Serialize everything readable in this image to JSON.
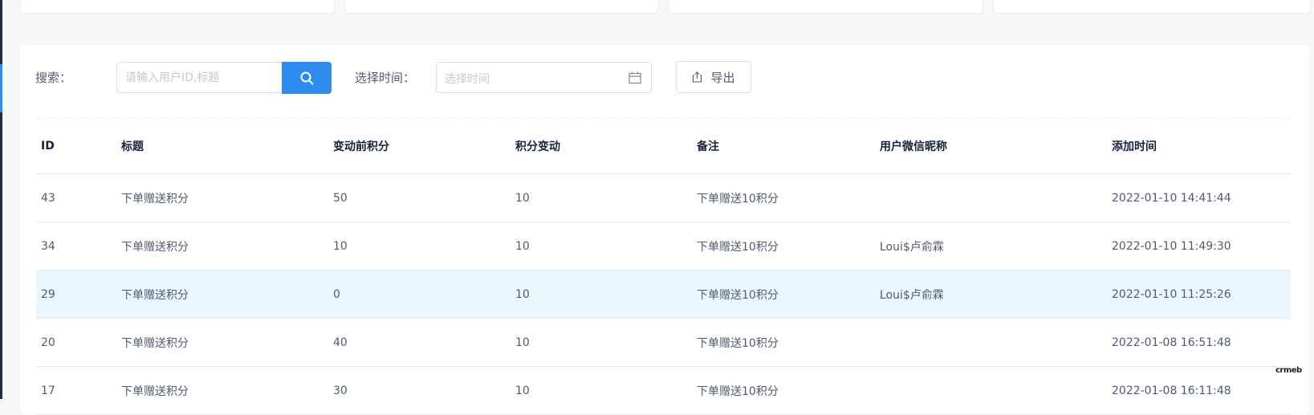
{
  "search": {
    "label": "搜索：",
    "placeholder": "请输入用户ID,标题",
    "icon": "search-icon"
  },
  "date_filter": {
    "label": "选择时间：",
    "placeholder": "选择时间",
    "icon": "calendar-icon"
  },
  "export": {
    "label": "导出",
    "icon": "export-icon"
  },
  "colors": {
    "primary": "#2d8cf0",
    "row_highlight": "#ebf7ff",
    "page_bg": "#f5f7f9"
  },
  "table": {
    "columns": [
      "ID",
      "标题",
      "变动前积分",
      "积分变动",
      "备注",
      "用户微信昵称",
      "添加时间"
    ],
    "rows": [
      [
        "43",
        "下单赠送积分",
        "50",
        "10",
        "下单赠送10积分",
        "",
        "2022-01-10 14:41:44"
      ],
      [
        "34",
        "下单赠送积分",
        "10",
        "10",
        "下单赠送10积分",
        "Loui$卢俞霖",
        "2022-01-10 11:49:30"
      ],
      [
        "29",
        "下单赠送积分",
        "0",
        "10",
        "下单赠送10积分",
        "Loui$卢俞霖",
        "2022-01-10 11:25:26"
      ],
      [
        "20",
        "下单赠送积分",
        "40",
        "10",
        "下单赠送10积分",
        "",
        "2022-01-08 16:51:48"
      ],
      [
        "17",
        "下单赠送积分",
        "30",
        "10",
        "下单赠送10积分",
        "",
        "2022-01-08 16:11:48"
      ]
    ],
    "highlighted_row": 2
  },
  "watermark": "crmeb"
}
